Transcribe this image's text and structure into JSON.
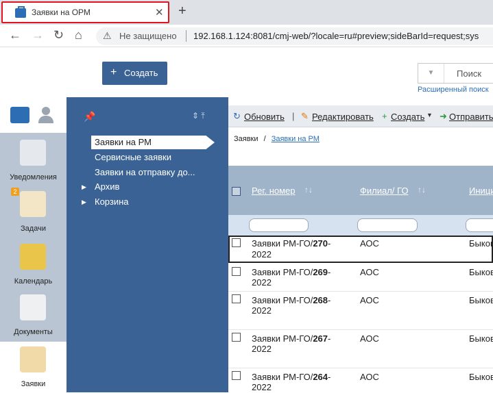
{
  "browser": {
    "tab_title": "Заявки на ОРМ",
    "tab_close": "✕",
    "new_tab": "+",
    "security_label": "Не защищено",
    "url": "192.168.1.124:8081/cmj-web/?locale=ru#preview;sideBarId=request;sys"
  },
  "header": {
    "create_label": "Создать",
    "search_label": "Поиск",
    "advanced_search": "Расширенный поиск"
  },
  "rail": {
    "items": [
      {
        "label": "Уведомления",
        "icon": "megaphone-icon"
      },
      {
        "label": "Задачи",
        "icon": "tasks-icon",
        "badge": "2"
      },
      {
        "label": "Календарь",
        "icon": "calendar-icon"
      },
      {
        "label": "Документы",
        "icon": "documents-icon"
      },
      {
        "label": "Заявки",
        "icon": "requests-icon"
      }
    ]
  },
  "folders": {
    "items": [
      "Заявки на РМ",
      "Сервисные заявки",
      "Заявки на отправку до...",
      "Архив",
      "Корзина"
    ]
  },
  "toolbar": {
    "refresh": "Обновить",
    "edit": "Редактировать",
    "create": "Создать",
    "send": "Отправить"
  },
  "breadcrumb": {
    "root": "Заявки",
    "sep": "/",
    "current": "Заявки на РМ"
  },
  "table": {
    "columns": [
      "Рег. номер",
      "Филиал/ ГО",
      "Иници"
    ],
    "rows": [
      {
        "prefix": "Заявки РМ-ГО/",
        "num": "270",
        "suffix": "-",
        "year": "2022",
        "branch": "АОС",
        "initiator": "Быков"
      },
      {
        "prefix": "Заявки РМ-ГО/",
        "num": "269",
        "suffix": "-",
        "year": "2022",
        "branch": "АОС",
        "initiator": "Быков"
      },
      {
        "prefix": "Заявки РМ-ГО/",
        "num": "268",
        "suffix": "-",
        "year": "2022",
        "branch": "АОС",
        "initiator": "Быков"
      },
      {
        "prefix": "Заявки РМ-ГО/",
        "num": "267",
        "suffix": "-",
        "year": "2022",
        "branch": "АОС",
        "initiator": "Быков"
      },
      {
        "prefix": "Заявки РМ-ГО/",
        "num": "264",
        "suffix": "-",
        "year": "2022",
        "branch": "АОС",
        "initiator": "Быков"
      }
    ]
  },
  "colors": {
    "accent": "#3a6295",
    "rail": "#b9c5d3",
    "table_header": "#9fb3c9"
  }
}
